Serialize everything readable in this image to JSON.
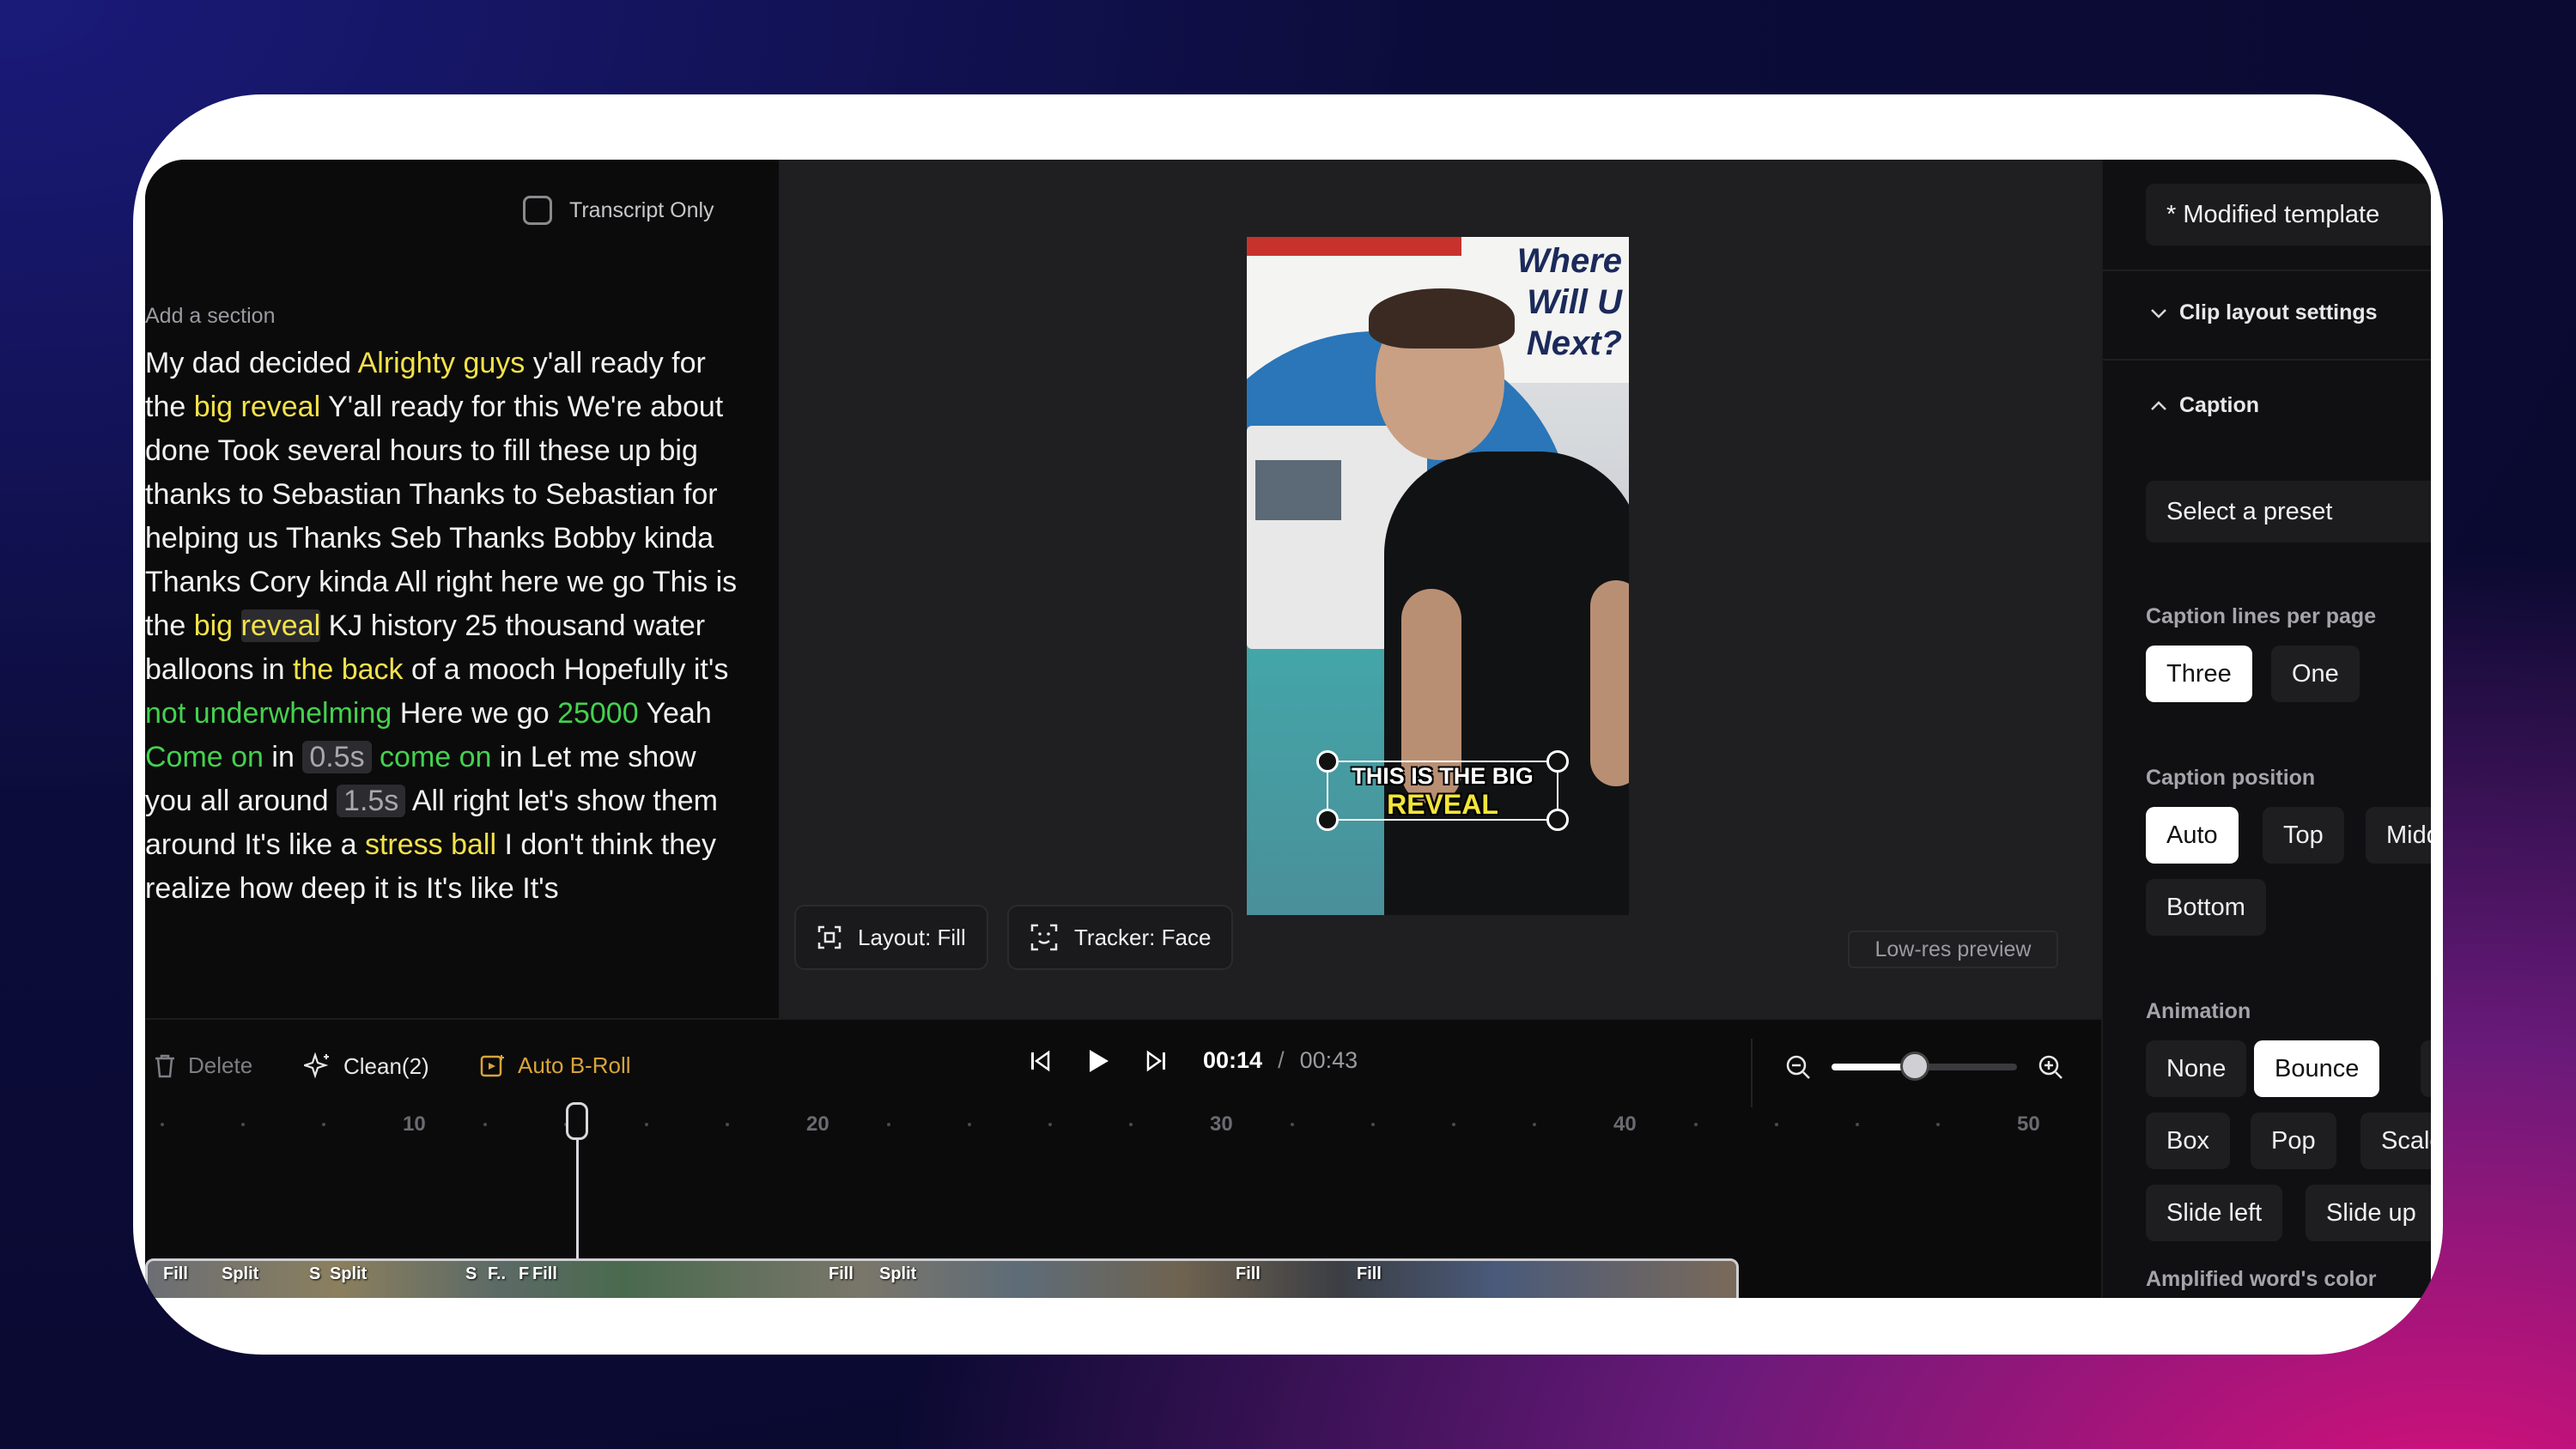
{
  "transcript": {
    "checkbox_label": "Transcript Only",
    "add_section": "Add a section",
    "segments": [
      {
        "t": "My dad decided ",
        "c": ""
      },
      {
        "t": "Alrighty guys",
        "c": "y"
      },
      {
        "t": " y'all ready for the ",
        "c": ""
      },
      {
        "t": "big reveal",
        "c": "y"
      },
      {
        "t": " Y'all ready for this We're about done Took several hours to fill these up big thanks to Sebastian Thanks to Sebastian for helping us Thanks Seb Thanks Bobby kinda Thanks Cory kinda All right here we go This is the ",
        "c": ""
      },
      {
        "t": "big",
        "c": "y"
      },
      {
        "t": " ",
        "c": ""
      },
      {
        "t": "reveal",
        "c": "yb"
      },
      {
        "t": " KJ history 25 thousand water balloons in ",
        "c": ""
      },
      {
        "t": "the back",
        "c": "y"
      },
      {
        "t": " of a mooch Hopefully it's ",
        "c": ""
      },
      {
        "t": "not underwhelming",
        "c": "g"
      },
      {
        "t": " Here we go ",
        "c": ""
      },
      {
        "t": "25000",
        "c": "g"
      },
      {
        "t": " Yeah ",
        "c": ""
      },
      {
        "t": "Come on",
        "c": "g"
      },
      {
        "t": " in ",
        "c": ""
      },
      {
        "t": "0.5s",
        "c": "p"
      },
      {
        "t": " ",
        "c": ""
      },
      {
        "t": "come on",
        "c": "g"
      },
      {
        "t": " in Let me show you all around ",
        "c": ""
      },
      {
        "t": "1.5s",
        "c": "p"
      },
      {
        "t": " All right let's show them around It's like a ",
        "c": ""
      },
      {
        "t": "stress ball",
        "c": "y"
      },
      {
        "t": " I don't think they realize how deep it is It's like It's",
        "c": ""
      }
    ]
  },
  "preview": {
    "sign_text": "Where Will U Next?",
    "caption_line1": "THIS IS THE BIG",
    "caption_line2": "REVEAL",
    "layout_label": "Layout: Fill",
    "tracker_label": "Tracker: Face",
    "lowres_label": "Low-res preview"
  },
  "settings": {
    "template": "* Modified template",
    "clip_layout": "Clip layout settings",
    "caption": "Caption",
    "preset_placeholder": "Select a preset",
    "lines_label": "Caption lines per page",
    "lines_options": [
      "Three",
      "One"
    ],
    "lines_selected": "Three",
    "position_label": "Caption position",
    "position_options": [
      "Auto",
      "Top",
      "Midd",
      "Bottom"
    ],
    "position_selected": "Auto",
    "animation_label": "Animation",
    "animation_options": [
      "None",
      "Bounce",
      "Box",
      "Pop",
      "Scale",
      "Slide left",
      "Slide up"
    ],
    "animation_selected": "Bounce",
    "amplified_label": "Amplified word's color"
  },
  "timeline": {
    "delete_label": "Delete",
    "clean_label": "Clean(2)",
    "broll_label": "Auto B-Roll",
    "current_time": "00:14",
    "separator": "/",
    "total_time": "00:43",
    "zoom_level": 0.45,
    "ticks": [
      "10",
      "20",
      "30",
      "40",
      "50"
    ],
    "clip_labels": [
      "Fill",
      "Split",
      "S",
      "Split",
      "S",
      "F..",
      "F",
      "Fill",
      "Fill",
      "Split",
      "Fill",
      "Fill"
    ]
  },
  "colors": {
    "highlight_yellow": "#f3e24a",
    "highlight_green": "#45d14e",
    "broll_accent": "#d8a43a"
  }
}
